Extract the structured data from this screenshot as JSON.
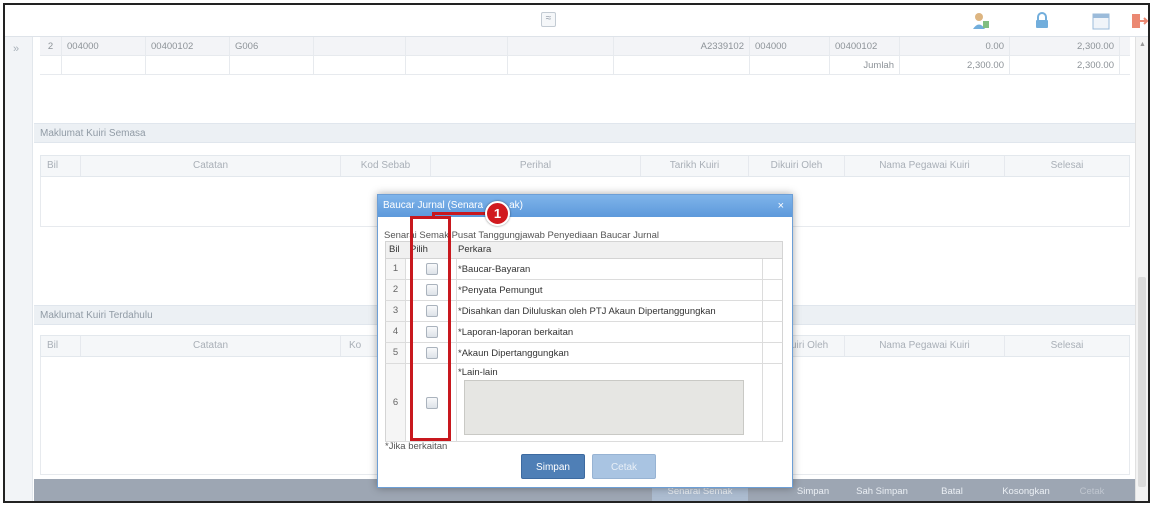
{
  "topbar": {
    "collapse_label": "≈"
  },
  "grid": {
    "row1": {
      "bil": "2",
      "c1": "004000",
      "c2": "00400102",
      "c3": "G006",
      "akaun": "A2339102",
      "c5": "004000",
      "c6": "00400102",
      "amt1": "0.00",
      "amt2": "2,300.00"
    },
    "row2": {
      "label": "Jumlah",
      "amt1": "2,300.00",
      "amt2": "2,300.00"
    }
  },
  "semasa": {
    "title": "Maklumat Kuiri Semasa",
    "columns": [
      "Bil",
      "Catatan",
      "Kod Sebab",
      "Perihal",
      "Tarikh Kuiri",
      "Dikuiri Oleh",
      "Nama Pegawai Kuiri",
      "Selesai"
    ]
  },
  "terdahulu": {
    "title": "Maklumat Kuiri Terdahulu",
    "columns": [
      "Bil",
      "Catatan",
      "Ko",
      "uiri Oleh",
      "Nama Pegawai Kuiri",
      "Selesai"
    ]
  },
  "bottombar": {
    "senarai_semak": "Senarai Semak",
    "simpan": "Simpan",
    "sah_simpan": "Sah Simpan",
    "batal": "Batal",
    "kosongkan": "Kosongkan",
    "cetak": "Cetak"
  },
  "dialog": {
    "title_left": "Baucar Jurnal (Senara",
    "title_right": "ak)",
    "close": "×",
    "subtitle": "Senarai Semak Pusat Tanggungjawab Penyediaan Baucar Jurnal",
    "headers": {
      "bil": "Bil",
      "pilih": "Pilih",
      "perkara": "Perkara"
    },
    "items": [
      {
        "bil": "1",
        "perkara": "*Baucar-Bayaran"
      },
      {
        "bil": "2",
        "perkara": "*Penyata Pemungut"
      },
      {
        "bil": "3",
        "perkara": "*Disahkan dan Diluluskan oleh PTJ Akaun Dipertanggungkan"
      },
      {
        "bil": "4",
        "perkara": "*Laporan-laporan berkaitan"
      },
      {
        "bil": "5",
        "perkara": "*Akaun Dipertanggungkan"
      },
      {
        "bil": "6",
        "perkara": "*Lain-lain"
      }
    ],
    "note": "*Jika berkaitan",
    "btn_simpan": "Simpan",
    "btn_cetak": "Cetak"
  },
  "annotation": {
    "marker": "1",
    "color": "#c8181e"
  },
  "colors": {
    "dialog_header": "#5d99db",
    "primary_button": "#4f7fb6",
    "toolbar": "#8c97a6"
  }
}
